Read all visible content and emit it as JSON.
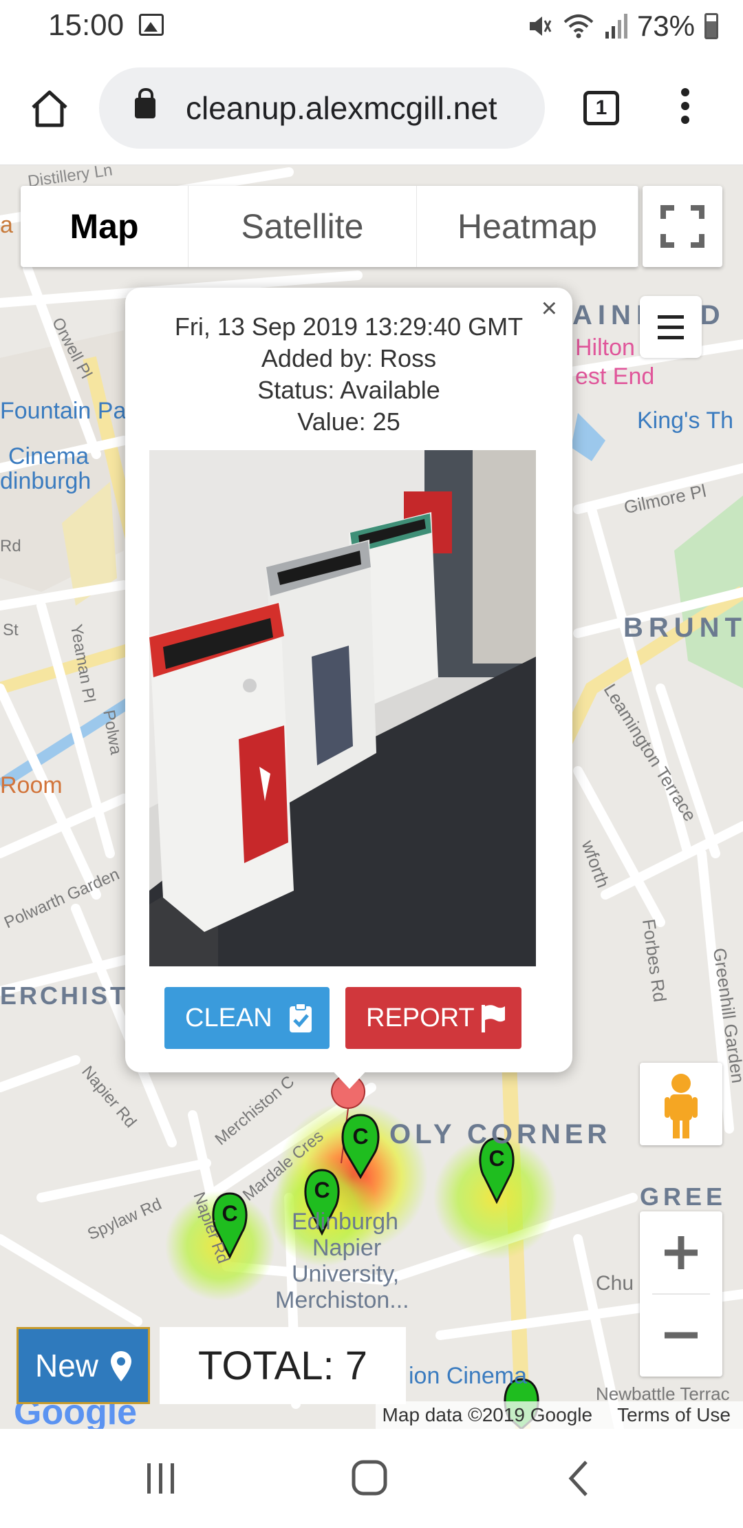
{
  "status_bar": {
    "time": "15:00",
    "battery": "73%",
    "icons": [
      "image-icon",
      "mute-icon",
      "wifi-icon",
      "signal-icon",
      "battery-icon"
    ]
  },
  "browser": {
    "url": "cleanup.alexmcgill.net",
    "tab_count": "1",
    "icons": [
      "home-icon",
      "lock-icon",
      "tabs-icon",
      "more-vert-icon"
    ]
  },
  "map_controls": {
    "map_types": [
      "Map",
      "Satellite",
      "Heatmap"
    ],
    "active_type": "Map"
  },
  "popup": {
    "close": "×",
    "date": "Fri, 13 Sep 2019 13:29:40 GMT",
    "added_by": "Added by: Ross",
    "status": "Status: Available",
    "value": "Value: 25",
    "clean_label": "CLEAN",
    "report_label": "REPORT"
  },
  "map_labels": {
    "distillery": "Distillery Ln",
    "orwell": "Orwell Pl",
    "fountain": "Fountain Pa",
    "cinema1": "Cinema",
    "cinema2": "dinburgh",
    "yeaman": "Yeaman Pl",
    "polwarth_short": "Polwa",
    "room": "Room",
    "polwarth_gardens": "Polwarth Garden",
    "merchiston_area": "ERCHIST",
    "napier_rd": "Napier Rd",
    "merchiston_cres": "Merchiston C",
    "mardale": "Mardale Cres",
    "sylaw": "Spylaw Rd",
    "napier_rd2": "Napier Rd",
    "uni1": "Edinburgh",
    "uni2": "Napier",
    "uni3": "University,",
    "uni4": "Merchiston...",
    "holy_corner": "OLY CORNER",
    "greenhill": "GREE",
    "chur": "Chu",
    "newbattle": "Newbattle Terrac",
    "cameo": "ion Cinema",
    "bruntsfield_area": "AINBRID",
    "hilton1": "Hilton",
    "hilton2": "est End",
    "kings": "King's Th",
    "gilmore": "Gilmore Pl",
    "brunt": "BRUNT",
    "leamington": "Leamington Terrace",
    "forbes": "Forbes Rd",
    "greenhill_gardens": "Greenhill Garden",
    "warrender": "wforth",
    "st": "St",
    "rd": "Rd",
    "a": "a"
  },
  "bottom": {
    "new_label": "New",
    "total": "TOTAL: 7",
    "map_data": "Map data ©2019 Google",
    "terms": "Terms of Use",
    "google": "Google"
  },
  "colors": {
    "map_bg": "#ebe9e5",
    "road": "#ffffff",
    "marker_green": "#1fbd1f",
    "marker_red": "#ef6b6b",
    "clean_button": "#3a9bdc",
    "report_button": "#d0373c",
    "new_button": "#2f7abd"
  }
}
